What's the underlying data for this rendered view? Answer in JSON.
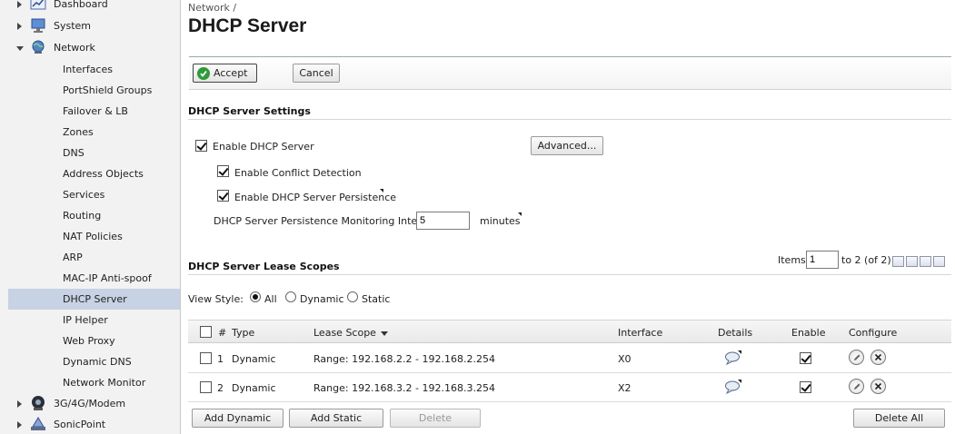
{
  "sidebar": {
    "top_items": [
      {
        "label": "Dashboard",
        "icon": "dashboard-icon"
      },
      {
        "label": "System",
        "icon": "monitor-icon"
      },
      {
        "label": "Network",
        "icon": "globe-icon"
      },
      {
        "label": "3G/4G/Modem",
        "icon": "modem-icon"
      },
      {
        "label": "SonicPoint",
        "icon": "access-point-icon"
      }
    ],
    "network_items": [
      {
        "label": "Interfaces"
      },
      {
        "label": "PortShield Groups"
      },
      {
        "label": "Failover & LB"
      },
      {
        "label": "Zones"
      },
      {
        "label": "DNS"
      },
      {
        "label": "Address Objects"
      },
      {
        "label": "Services"
      },
      {
        "label": "Routing"
      },
      {
        "label": "NAT Policies"
      },
      {
        "label": "ARP"
      },
      {
        "label": "MAC-IP Anti-spoof"
      },
      {
        "label": "DHCP Server"
      },
      {
        "label": "IP Helper"
      },
      {
        "label": "Web Proxy"
      },
      {
        "label": "Dynamic DNS"
      },
      {
        "label": "Network Monitor"
      }
    ],
    "active_item": "DHCP Server"
  },
  "header": {
    "breadcrumb": "Network /",
    "title": "DHCP Server"
  },
  "toolbar": {
    "accept_label": "Accept",
    "cancel_label": "Cancel"
  },
  "settings": {
    "title": "DHCP Server Settings",
    "enable_dhcp_label": "Enable DHCP Server",
    "enable_dhcp_checked": true,
    "advanced_label": "Advanced...",
    "conflict_label": "Enable Conflict Detection",
    "conflict_checked": true,
    "persistence_label": "Enable DHCP Server Persistence",
    "persistence_checked": true,
    "interval_label": "DHCP Server Persistence Monitoring Interval:",
    "interval_value": "5",
    "interval_unit": "minutes"
  },
  "scopes": {
    "title": "DHCP Server Lease Scopes",
    "items_label": "Items",
    "items_value": "1",
    "items_range": "to 2 (of 2)",
    "view_style_label": "View Style:",
    "view_options": [
      "All",
      "Dynamic",
      "Static"
    ],
    "view_selected": "All",
    "columns": {
      "num": "#",
      "type": "Type",
      "lease_scope": "Lease Scope",
      "interface": "Interface",
      "details": "Details",
      "enable": "Enable",
      "configure": "Configure"
    },
    "rows": [
      {
        "num": "1",
        "type": "Dynamic",
        "lease_scope": "Range: 192.168.2.2 - 192.168.2.254",
        "interface": "X0",
        "enabled": true
      },
      {
        "num": "2",
        "type": "Dynamic",
        "lease_scope": "Range: 192.168.3.2 - 192.168.3.254",
        "interface": "X2",
        "enabled": true
      }
    ],
    "add_dynamic_label": "Add Dynamic",
    "add_static_label": "Add Static",
    "delete_label": "Delete",
    "delete_all_label": "Delete All"
  },
  "colors": {
    "active_nav_bg": "#c7d2e4",
    "accept_icon": "#2f9a3a"
  }
}
